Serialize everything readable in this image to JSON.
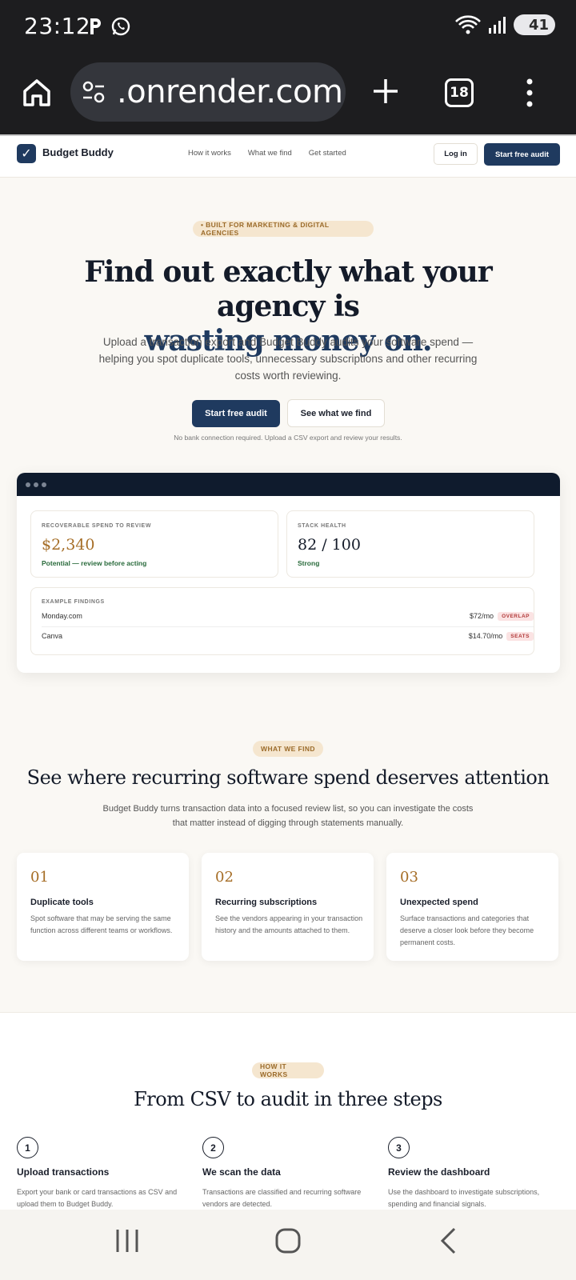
{
  "status_bar": {
    "time": "23:12",
    "battery": "41"
  },
  "browser": {
    "url": ".onrender.com",
    "tab_count": "18"
  },
  "nav": {
    "brand": "Budget Buddy",
    "links": [
      "How it works",
      "What we find",
      "Get started"
    ],
    "login": "Log in",
    "cta": "Start free audit"
  },
  "hero": {
    "badge": "• BUILT FOR MARKETING & DIGITAL AGENCIES",
    "title_line1": "Find out exactly what your agency is",
    "title_line2": "wasting money on.",
    "subtitle": "Upload a transaction export and Budget Buddy audits your software spend — helping you spot duplicate tools, unnecessary subscriptions and other recurring costs worth reviewing.",
    "primary_cta": "Start free audit",
    "secondary_cta": "See what we find",
    "note": "No bank connection required. Upload a CSV export and review your results."
  },
  "dashboard": {
    "recoverable": {
      "label": "RECOVERABLE SPEND TO REVIEW",
      "value": "$2,340",
      "note": "Potential — review before acting"
    },
    "health": {
      "label": "STACK HEALTH",
      "value": "82 / 100",
      "note": "Strong"
    },
    "findings_label": "EXAMPLE FINDINGS",
    "findings": [
      {
        "vendor": "Monday.com",
        "amount": "$72/mo",
        "tag": "OVERLAP"
      },
      {
        "vendor": "Canva",
        "amount": "$14.70/mo",
        "tag": "SEATS"
      }
    ]
  },
  "find_section": {
    "badge": "WHAT WE FIND",
    "title": "See where recurring software spend deserves attention",
    "subtitle": "Budget Buddy turns transaction data into a focused review list, so you can investigate the costs that matter instead of digging through statements manually.",
    "features": [
      {
        "num": "01",
        "title": "Duplicate tools",
        "text": "Spot software that may be serving the same function across different teams or workflows."
      },
      {
        "num": "02",
        "title": "Recurring subscriptions",
        "text": "See the vendors appearing in your transaction history and the amounts attached to them."
      },
      {
        "num": "03",
        "title": "Unexpected spend",
        "text": "Surface transactions and categories that deserve a closer look before they become permanent costs."
      }
    ]
  },
  "how_section": {
    "badge": "HOW IT WORKS",
    "title": "From CSV to audit in three steps",
    "steps": [
      {
        "num": "1",
        "title": "Upload transactions",
        "text": "Export your bank or card transactions as CSV and upload them to Budget Buddy."
      },
      {
        "num": "2",
        "title": "We scan the data",
        "text": "Transactions are classified and recurring software vendors are detected."
      },
      {
        "num": "3",
        "title": "Review the dashboard",
        "text": "Use the dashboard to investigate subscriptions, spending and financial signals."
      }
    ]
  },
  "colors": {
    "navy": "#1f3a5f",
    "gold": "#a66e27",
    "badge_bg": "#f5e6cf",
    "page_bg": "#faf8f4"
  },
  "icons": [
    "home-icon",
    "site-settings-icon",
    "new-tab-icon",
    "more-menu-icon",
    "recents-icon",
    "home-button-icon",
    "back-icon"
  ]
}
